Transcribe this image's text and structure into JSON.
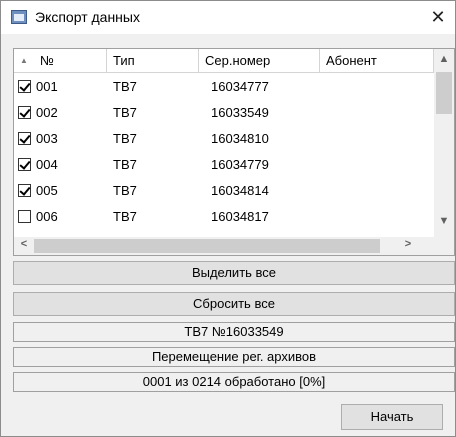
{
  "window": {
    "title": "Экспорт данных",
    "close_glyph": "✕"
  },
  "table": {
    "columns": [
      "№",
      "Тип",
      "Сер.номер",
      "Абонент"
    ],
    "rows": [
      {
        "checked": true,
        "num": "001",
        "type": "ТВ7",
        "serial": "16034777",
        "subscriber": ""
      },
      {
        "checked": true,
        "num": "002",
        "type": "ТВ7",
        "serial": "16033549",
        "subscriber": ""
      },
      {
        "checked": true,
        "num": "003",
        "type": "ТВ7",
        "serial": "16034810",
        "subscriber": ""
      },
      {
        "checked": true,
        "num": "004",
        "type": "ТВ7",
        "serial": "16034779",
        "subscriber": ""
      },
      {
        "checked": true,
        "num": "005",
        "type": "ТВ7",
        "serial": "16034814",
        "subscriber": ""
      },
      {
        "checked": false,
        "num": "006",
        "type": "ТВ7",
        "serial": "16034817",
        "subscriber": ""
      }
    ],
    "sort_glyph": "▲",
    "scroll_up": "▲",
    "scroll_down": "▼",
    "scroll_left": "<",
    "scroll_right": ">"
  },
  "buttons": {
    "select_all": "Выделить все",
    "reset_all": "Сбросить все",
    "start": "Начать"
  },
  "status": {
    "device": "ТВ7 №16033549",
    "operation": "Перемещение рег. архивов",
    "progress": "0001 из 0214 обработано [0%]"
  }
}
